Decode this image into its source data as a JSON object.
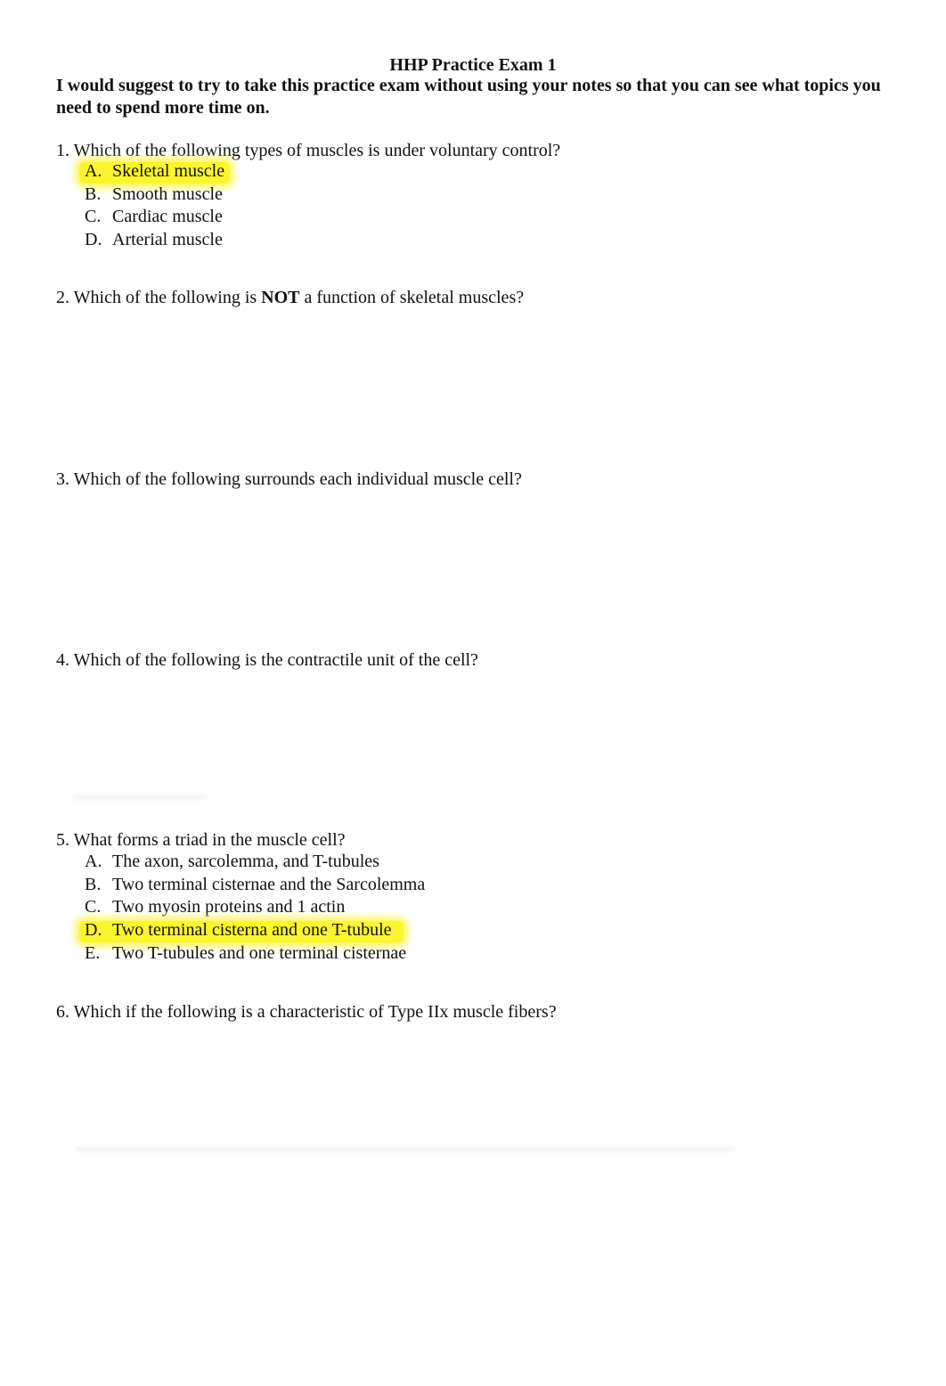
{
  "document": {
    "title": "HHP Practice Exam 1",
    "intro": "I would suggest to try to take this practice exam without using your notes so that you can see what topics you need to spend more time on."
  },
  "highlight_color": "#fdf52b",
  "questions": [
    {
      "number": "1.",
      "text": "Which of the following types of muscles is under voluntary control?",
      "options": [
        {
          "letter": "A.",
          "text": "Skeletal muscle",
          "highlighted": true
        },
        {
          "letter": "B.",
          "text": "Smooth muscle",
          "highlighted": false
        },
        {
          "letter": "C.",
          "text": "Cardiac muscle",
          "highlighted": false
        },
        {
          "letter": "D.",
          "text": "Arterial muscle",
          "highlighted": false
        }
      ]
    },
    {
      "number": "2.",
      "text_before": "Which of the following is",
      "text_bold": "NOT",
      "text_after": "a function of skeletal muscles?",
      "options": []
    },
    {
      "number": "3.",
      "text": "Which of the following surrounds each individual muscle cell?",
      "options": []
    },
    {
      "number": "4.",
      "text": "Which of the following is the contractile unit of the cell?",
      "options": []
    },
    {
      "number": "5.",
      "text": "What forms a triad in the muscle cell?",
      "options": [
        {
          "letter": "A.",
          "text": "The axon, sarcolemma, and T-tubules",
          "highlighted": false
        },
        {
          "letter": "B.",
          "text": "Two terminal cisternae and the Sarcolemma",
          "highlighted": false
        },
        {
          "letter": "C.",
          "text": "Two myosin proteins and 1 actin",
          "highlighted": false
        },
        {
          "letter": "D.",
          "text": "Two terminal cisterna and one T-tubule",
          "highlighted": true
        },
        {
          "letter": "E.",
          "text": "Two T-tubules and one terminal cisternae",
          "highlighted": false
        }
      ]
    },
    {
      "number": "6.",
      "text": "Which if the following is a characteristic of Type IIx muscle fibers?",
      "options": []
    }
  ]
}
